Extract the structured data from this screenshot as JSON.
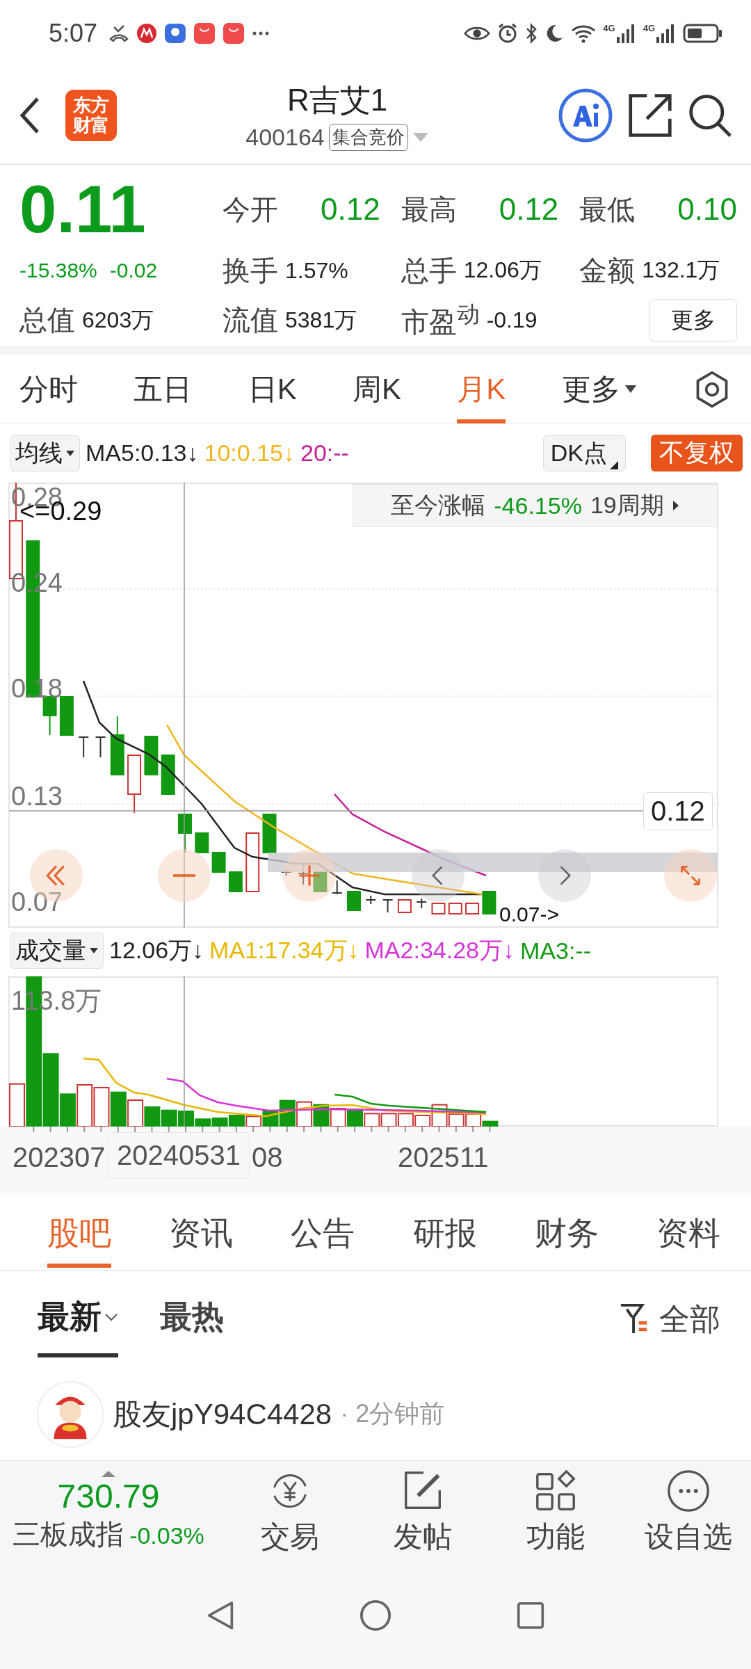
{
  "status_bar": {
    "time": "5:07",
    "network_labels": [
      "4G",
      "4G"
    ]
  },
  "header": {
    "logo_lines": [
      "东方",
      "财富"
    ],
    "title": "R吉艾1",
    "code": "400164",
    "badge": "集合竞价"
  },
  "quote": {
    "price": "0.11",
    "color": "#0c9b1c",
    "change_pct": "-15.38%",
    "change": "-0.02",
    "rows": [
      [
        {
          "label": "今开",
          "value": "0.12",
          "color": "#0c9b1c"
        },
        {
          "label": "最高",
          "value": "0.12",
          "color": "#0c9b1c"
        },
        {
          "label": "最低",
          "value": "0.10",
          "color": "#0c9b1c"
        }
      ],
      [
        {
          "label": "换手",
          "value": "1.57%",
          "color": "#222222"
        },
        {
          "label": "总手",
          "value": "12.06万",
          "color": "#222222"
        },
        {
          "label": "金额",
          "value": "132.1万",
          "color": "#222222"
        }
      ],
      [
        {
          "label": "流值",
          "value": "5381万",
          "color": "#222222"
        },
        {
          "label": "市盈$^{动}$",
          "value": "-0.19",
          "color": "#222222"
        }
      ]
    ],
    "total_value": {
      "label": "总值",
      "value": "6203万"
    },
    "more_button": "更多"
  },
  "period_tabs": [
    {
      "label": "分时",
      "selected": false,
      "kind": "plain"
    },
    {
      "label": "五日",
      "selected": false,
      "kind": "plain"
    },
    {
      "label": "日K",
      "selected": false,
      "kind": "plain"
    },
    {
      "label": "周K",
      "selected": false,
      "kind": "plain"
    },
    {
      "label": "月K",
      "selected": true,
      "kind": "plain"
    },
    {
      "label": "更多",
      "selected": false,
      "kind": "dropdown"
    }
  ],
  "ma_bar": {
    "selector": "均线",
    "items": [
      {
        "text": "MA5:0.13↓",
        "color": "#222222"
      },
      {
        "text": "10:0.15↓",
        "color": "#f2b51c"
      },
      {
        "text": "20:--",
        "color": "#c81e96"
      }
    ],
    "dk_button": "DK点",
    "adjust_button": "不复权"
  },
  "kline": {
    "y_labels": [
      "0.28",
      "0.24",
      "0.18",
      "0.13",
      "0.07"
    ],
    "max_marker": "<=0.29",
    "min_marker": "0.07->",
    "range_info": {
      "label": "至今涨幅",
      "value": "-46.15%",
      "periods": "19周期"
    },
    "crosshair_price": "0.12"
  },
  "volume": {
    "selector": "成交量",
    "value": "12.06万↓",
    "items": [
      {
        "text": "MA1:17.34万↓",
        "color": "#e8b800"
      },
      {
        "text": "MA2:34.28万↓",
        "color": "#d633d6"
      },
      {
        "text": "MA3:--",
        "color": "#139a13"
      }
    ],
    "max_label": "113.8万"
  },
  "date_axis": {
    "labels": [
      "202307",
      "08",
      "202511"
    ],
    "crosshair_date": "20240531"
  },
  "news_tabs": [
    {
      "label": "股吧",
      "selected": true
    },
    {
      "label": "资讯",
      "selected": false
    },
    {
      "label": "公告",
      "selected": false
    },
    {
      "label": "研报",
      "selected": false
    },
    {
      "label": "财务",
      "selected": false
    },
    {
      "label": "资料",
      "selected": false
    }
  ],
  "sort_tabs": [
    {
      "label": "最新",
      "selected": true,
      "kind": "dropdown"
    },
    {
      "label": "最热",
      "selected": false,
      "kind": "plain"
    }
  ],
  "filter": "全部",
  "post": {
    "author": "股友jpY94C4428",
    "time": "· 2分钟前"
  },
  "bottom_bar": {
    "index_value": "730.79",
    "index_name": "三板成指",
    "index_change": "-0.03%",
    "color": "#0c9b1c",
    "actions": [
      {
        "label": "交易",
        "kind": "trade"
      },
      {
        "label": "发帖",
        "kind": "post"
      },
      {
        "label": "功能",
        "kind": "functions"
      },
      {
        "label": "设自选",
        "kind": "watchlist"
      }
    ]
  }
}
